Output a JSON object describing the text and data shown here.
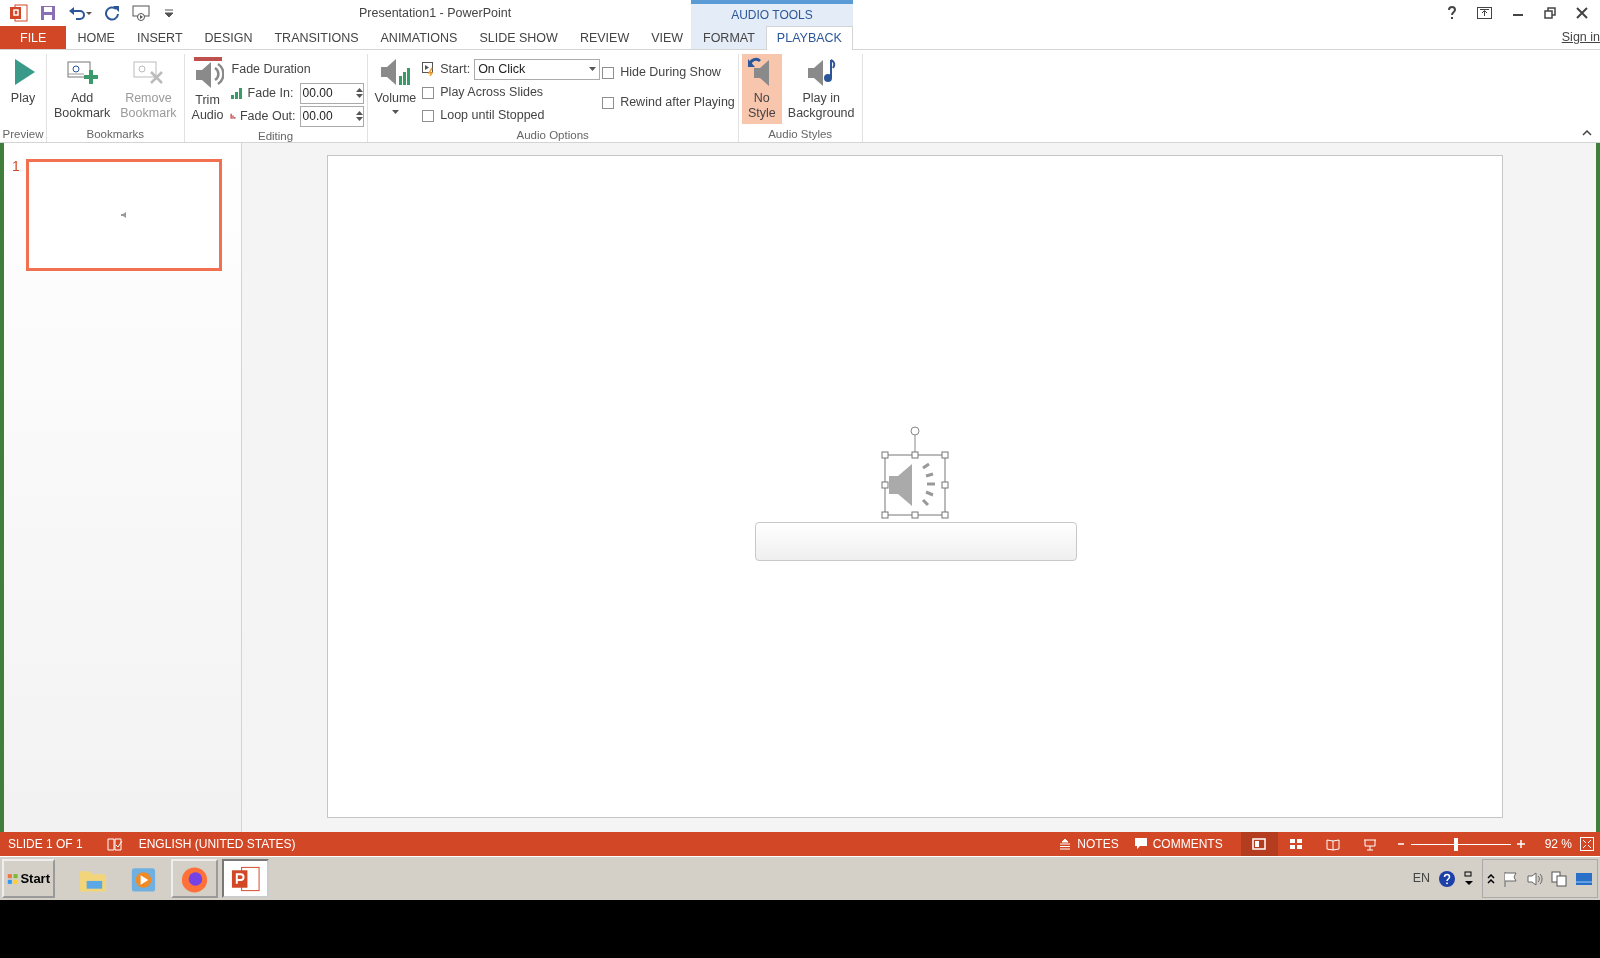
{
  "window": {
    "title": "Presentation1 - PowerPoint"
  },
  "contextual_group": {
    "label": "AUDIO TOOLS"
  },
  "tabs": [
    {
      "label": "FILE",
      "kind": "file",
      "selected": false
    },
    {
      "label": "HOME",
      "kind": "tab",
      "selected": false
    },
    {
      "label": "INSERT",
      "kind": "tab",
      "selected": false
    },
    {
      "label": "DESIGN",
      "kind": "tab",
      "selected": false
    },
    {
      "label": "TRANSITIONS",
      "kind": "tab",
      "selected": false
    },
    {
      "label": "ANIMATIONS",
      "kind": "tab",
      "selected": false
    },
    {
      "label": "SLIDE SHOW",
      "kind": "tab",
      "selected": false
    },
    {
      "label": "REVIEW",
      "kind": "tab",
      "selected": false
    },
    {
      "label": "VIEW",
      "kind": "tab",
      "selected": false
    },
    {
      "label": "FORMAT",
      "kind": "contextual",
      "selected": false
    },
    {
      "label": "PLAYBACK",
      "kind": "contextual",
      "selected": true
    }
  ],
  "sign_in": "Sign in",
  "ribbon": {
    "groups": [
      {
        "label": "Preview",
        "columns": [
          [
            {
              "kind": "large",
              "label": "Play",
              "disabled": false,
              "selected": false
            }
          ]
        ]
      },
      {
        "label": "Bookmarks",
        "columns": [
          [
            {
              "kind": "large",
              "label": "Add\nBookmark",
              "disabled": false,
              "selected": false
            }
          ],
          [
            {
              "kind": "large",
              "label": "Remove\nBookmark",
              "disabled": true,
              "selected": false
            }
          ]
        ]
      },
      {
        "label": "Editing",
        "columns": [
          [
            {
              "kind": "large",
              "label": "Trim\nAudio",
              "disabled": false,
              "selected": false
            }
          ],
          [
            {
              "kind": "heading",
              "text": "Fade Duration"
            },
            {
              "kind": "spinner",
              "label": "Fade In:",
              "value": "00.00"
            },
            {
              "kind": "spinner",
              "label": "Fade Out:",
              "value": "00.00"
            }
          ]
        ]
      },
      {
        "label": "Audio Options",
        "columns": [
          [
            {
              "kind": "menu",
              "label": "Volume",
              "disabled": false,
              "selected": false
            }
          ],
          [
            {
              "kind": "dropdown",
              "label": "Start:",
              "value": "On Click"
            },
            {
              "kind": "checkbox",
              "label": "Play Across Slides",
              "checked": false
            },
            {
              "kind": "checkbox",
              "label": "Loop until Stopped",
              "checked": false
            }
          ],
          [
            {
              "kind": "checkbox",
              "label": "Hide During Show",
              "checked": false
            },
            {
              "kind": "checkbox",
              "label": "Rewind after Playing",
              "checked": false
            }
          ]
        ]
      },
      {
        "label": "Audio Styles",
        "columns": [
          [
            {
              "kind": "large",
              "label": "No\nStyle",
              "disabled": false,
              "selected": true
            }
          ],
          [
            {
              "kind": "large",
              "label": "Play in\nBackground",
              "disabled": false,
              "selected": false
            }
          ]
        ]
      }
    ]
  },
  "slides": [
    {
      "number": "1",
      "selected": true
    }
  ],
  "status_bar": {
    "slide_indicator": "SLIDE 1 OF 1",
    "language": "ENGLISH (UNITED STATES)",
    "notes": "NOTES",
    "comments": "COMMENTS",
    "views": [
      {
        "selected": true
      },
      {
        "selected": false
      },
      {
        "selected": false
      },
      {
        "selected": false
      }
    ],
    "zoom": {
      "level": 0.45,
      "reading": "92 %"
    }
  },
  "taskbar": {
    "start": "Start",
    "apps": [
      {
        "selected": false,
        "open": false
      },
      {
        "selected": false,
        "open": false
      },
      {
        "selected": false,
        "open": true
      },
      {
        "selected": true,
        "open": true
      }
    ],
    "language": "EN"
  }
}
